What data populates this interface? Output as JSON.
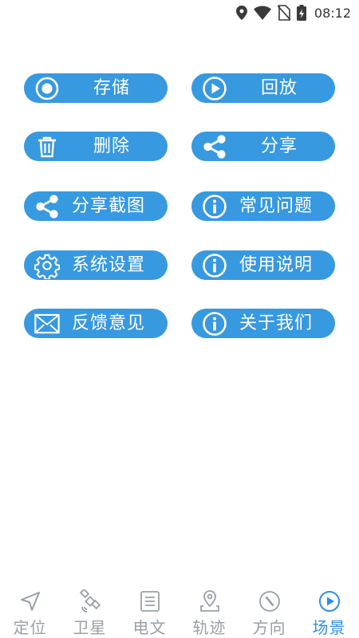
{
  "status_bar": {
    "time": "08:12"
  },
  "buttons": [
    {
      "label": "存储",
      "icon": "record-icon"
    },
    {
      "label": "回放",
      "icon": "play-icon"
    },
    {
      "label": "删除",
      "icon": "trash-icon"
    },
    {
      "label": "分享",
      "icon": "share-icon"
    },
    {
      "label": "分享截图",
      "icon": "share-icon"
    },
    {
      "label": "常见问题",
      "icon": "info-icon"
    },
    {
      "label": "系统设置",
      "icon": "gear-icon"
    },
    {
      "label": "使用说明",
      "icon": "info-icon"
    },
    {
      "label": "反馈意见",
      "icon": "mail-icon"
    },
    {
      "label": "关于我们",
      "icon": "info-icon"
    }
  ],
  "tabs": [
    {
      "label": "定位",
      "icon": "navigation-arrow-icon",
      "active": false
    },
    {
      "label": "卫星",
      "icon": "satellite-icon",
      "active": false
    },
    {
      "label": "电文",
      "icon": "document-icon",
      "active": false
    },
    {
      "label": "轨迹",
      "icon": "location-pin-icon",
      "active": false
    },
    {
      "label": "方向",
      "icon": "compass-icon",
      "active": false
    },
    {
      "label": "场景",
      "icon": "play-circle-icon",
      "active": true
    }
  ],
  "colors": {
    "accent": "#3799e0",
    "tab_inactive": "#9aa0a6",
    "tab_active": "#2f8ee0"
  }
}
